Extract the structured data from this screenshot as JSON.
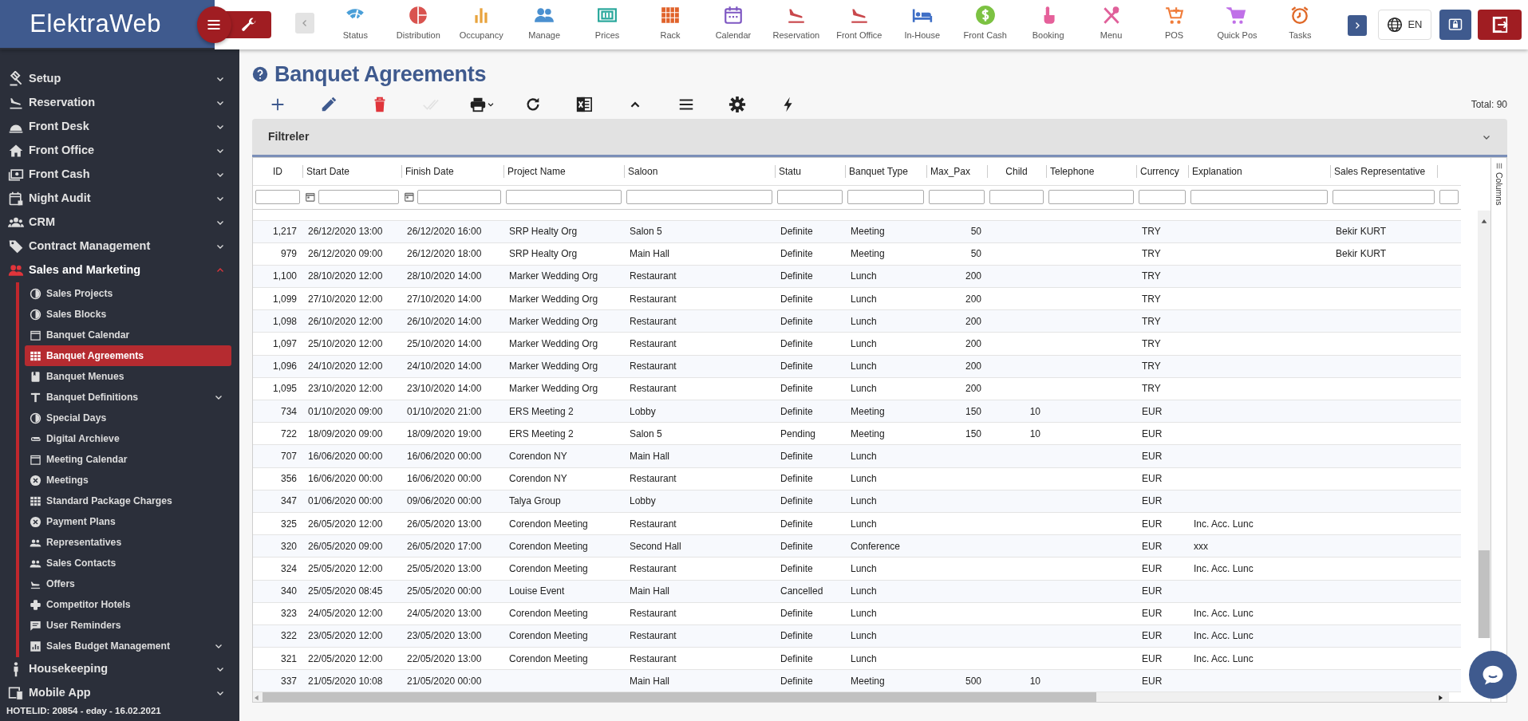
{
  "app": {
    "logo": "ElektraWeb"
  },
  "modules": [
    {
      "label": "Status"
    },
    {
      "label": "Distribution"
    },
    {
      "label": "Occupancy"
    },
    {
      "label": "Manage"
    },
    {
      "label": "Prices"
    },
    {
      "label": "Rack"
    },
    {
      "label": "Calendar"
    },
    {
      "label": "Reservation"
    },
    {
      "label": "Front Office"
    },
    {
      "label": "In-House"
    },
    {
      "label": "Front Cash"
    },
    {
      "label": "Booking"
    },
    {
      "label": "Menu"
    },
    {
      "label": "POS"
    },
    {
      "label": "Quick Pos"
    },
    {
      "label": "Tasks"
    }
  ],
  "language": {
    "label": "EN"
  },
  "sidebar": {
    "items": [
      {
        "label": "Setup",
        "expanded": false
      },
      {
        "label": "Reservation",
        "expanded": false
      },
      {
        "label": "Front Desk",
        "expanded": false
      },
      {
        "label": "Front Office",
        "expanded": false
      },
      {
        "label": "Front Cash",
        "expanded": false
      },
      {
        "label": "Night Audit",
        "expanded": false
      },
      {
        "label": "CRM",
        "expanded": false
      },
      {
        "label": "Contract Management",
        "expanded": false
      },
      {
        "label": "Sales and Marketing",
        "expanded": true,
        "children": [
          {
            "label": "Sales Projects",
            "selected": false,
            "expandable": false
          },
          {
            "label": "Sales Blocks",
            "selected": false,
            "expandable": false
          },
          {
            "label": "Banquet Calendar",
            "selected": false,
            "expandable": false
          },
          {
            "label": "Banquet Agreements",
            "selected": true,
            "expandable": false
          },
          {
            "label": "Banquet Menues",
            "selected": false,
            "expandable": false
          },
          {
            "label": "Banquet Definitions",
            "selected": false,
            "expandable": true
          },
          {
            "label": "Special Days",
            "selected": false,
            "expandable": false
          },
          {
            "label": "Digital Archieve",
            "selected": false,
            "expandable": false
          },
          {
            "label": "Meeting Calendar",
            "selected": false,
            "expandable": false
          },
          {
            "label": "Meetings",
            "selected": false,
            "expandable": false
          },
          {
            "label": "Standard Package Charges",
            "selected": false,
            "expandable": false
          },
          {
            "label": "Payment Plans",
            "selected": false,
            "expandable": false
          },
          {
            "label": "Representatives",
            "selected": false,
            "expandable": false
          },
          {
            "label": "Sales Contacts",
            "selected": false,
            "expandable": false
          },
          {
            "label": "Offers",
            "selected": false,
            "expandable": false
          },
          {
            "label": "Competitor Hotels",
            "selected": false,
            "expandable": false
          },
          {
            "label": "User Reminders",
            "selected": false,
            "expandable": false
          },
          {
            "label": "Sales Budget Management",
            "selected": false,
            "expandable": true
          }
        ]
      },
      {
        "label": "Housekeeping",
        "expanded": false
      },
      {
        "label": "Mobile App",
        "expanded": false
      }
    ],
    "footer": "HOTELID: 20854 - eday - 16.02.2021"
  },
  "page": {
    "title": "Banquet Agreements",
    "total": "Total: 90"
  },
  "toolbar": [
    {
      "kind": "add",
      "disabled": false
    },
    {
      "kind": "edit",
      "disabled": false
    },
    {
      "kind": "delete",
      "disabled": false
    },
    {
      "kind": "approve",
      "disabled": true
    },
    {
      "kind": "print",
      "disabled": false
    },
    {
      "kind": "refresh",
      "disabled": false
    },
    {
      "kind": "excel",
      "disabled": false
    },
    {
      "kind": "collapse",
      "disabled": false
    },
    {
      "kind": "menu",
      "disabled": false
    },
    {
      "kind": "settings",
      "disabled": false
    },
    {
      "kind": "flash",
      "disabled": false
    }
  ],
  "filter_panel": {
    "title": "Filtreler",
    "expanded": false
  },
  "side_tab": {
    "label": "Columns"
  },
  "table": {
    "columns": [
      "ID",
      "Start Date",
      "Finish Date",
      "Project Name",
      "Saloon",
      "Statu",
      "Banquet Type",
      "Max_Pax",
      "Child",
      "Telephone",
      "Currency",
      "Explanation",
      "Sales Representative"
    ],
    "rows": [
      [
        "1,217",
        "26/12/2020 13:00",
        "26/12/2020 16:00",
        "SRP Healty Org",
        "Salon 5",
        "Definite",
        "Meeting",
        "50",
        null,
        null,
        "TRY",
        null,
        "Bekir KURT"
      ],
      [
        "979",
        "26/12/2020 09:00",
        "26/12/2020 18:00",
        "SRP Healty Org",
        "Main Hall",
        "Definite",
        "Meeting",
        "50",
        null,
        null,
        "TRY",
        null,
        "Bekir KURT"
      ],
      [
        "1,100",
        "28/10/2020 12:00",
        "28/10/2020 14:00",
        "Marker Wedding Org",
        "Restaurant",
        "Definite",
        "Lunch",
        "200",
        null,
        null,
        "TRY",
        null,
        null
      ],
      [
        "1,099",
        "27/10/2020 12:00",
        "27/10/2020 14:00",
        "Marker Wedding Org",
        "Restaurant",
        "Definite",
        "Lunch",
        "200",
        null,
        null,
        "TRY",
        null,
        null
      ],
      [
        "1,098",
        "26/10/2020 12:00",
        "26/10/2020 14:00",
        "Marker Wedding Org",
        "Restaurant",
        "Definite",
        "Lunch",
        "200",
        null,
        null,
        "TRY",
        null,
        null
      ],
      [
        "1,097",
        "25/10/2020 12:00",
        "25/10/2020 14:00",
        "Marker Wedding Org",
        "Restaurant",
        "Definite",
        "Lunch",
        "200",
        null,
        null,
        "TRY",
        null,
        null
      ],
      [
        "1,096",
        "24/10/2020 12:00",
        "24/10/2020 14:00",
        "Marker Wedding Org",
        "Restaurant",
        "Definite",
        "Lunch",
        "200",
        null,
        null,
        "TRY",
        null,
        null
      ],
      [
        "1,095",
        "23/10/2020 12:00",
        "23/10/2020 14:00",
        "Marker Wedding Org",
        "Restaurant",
        "Definite",
        "Lunch",
        "200",
        null,
        null,
        "TRY",
        null,
        null
      ],
      [
        "734",
        "01/10/2020 09:00",
        "01/10/2020 21:00",
        "ERS Meeting 2",
        "Lobby",
        "Definite",
        "Meeting",
        "150",
        "10",
        null,
        "EUR",
        null,
        null
      ],
      [
        "722",
        "18/09/2020 09:00",
        "18/09/2020 19:00",
        "ERS Meeting 2",
        "Salon 5",
        "Pending",
        "Meeting",
        "150",
        "10",
        null,
        "EUR",
        null,
        null
      ],
      [
        "707",
        "16/06/2020 00:00",
        "16/06/2020 00:00",
        "Corendon NY",
        "Main Hall",
        "Definite",
        "Lunch",
        null,
        null,
        null,
        "EUR",
        null,
        null
      ],
      [
        "356",
        "16/06/2020 00:00",
        "16/06/2020 00:00",
        "Corendon NY",
        "Restaurant",
        "Definite",
        "Lunch",
        null,
        null,
        null,
        "EUR",
        null,
        null
      ],
      [
        "347",
        "01/06/2020 00:00",
        "09/06/2020 00:00",
        "Talya Group",
        "Lobby",
        "Definite",
        "Lunch",
        null,
        null,
        null,
        "EUR",
        null,
        null
      ],
      [
        "325",
        "26/05/2020 12:00",
        "26/05/2020 13:00",
        "Corendon Meeting",
        "Restaurant",
        "Definite",
        "Lunch",
        null,
        null,
        null,
        "EUR",
        "Inc. Acc. Lunc",
        null
      ],
      [
        "320",
        "26/05/2020 09:00",
        "26/05/2020 17:00",
        "Corendon Meeting",
        "Second Hall",
        "Definite",
        "Conference",
        null,
        null,
        null,
        "EUR",
        "xxx",
        null
      ],
      [
        "324",
        "25/05/2020 12:00",
        "25/05/2020 13:00",
        "Corendon Meeting",
        "Restaurant",
        "Definite",
        "Lunch",
        null,
        null,
        null,
        "EUR",
        "Inc. Acc. Lunc",
        null
      ],
      [
        "340",
        "25/05/2020 08:45",
        "25/05/2020 00:00",
        "Louise Event",
        "Main Hall",
        "Cancelled",
        "Lunch",
        null,
        null,
        null,
        "EUR",
        null,
        null
      ],
      [
        "323",
        "24/05/2020 12:00",
        "24/05/2020 13:00",
        "Corendon Meeting",
        "Restaurant",
        "Definite",
        "Lunch",
        null,
        null,
        null,
        "EUR",
        "Inc. Acc. Lunc",
        null
      ],
      [
        "322",
        "23/05/2020 12:00",
        "23/05/2020 13:00",
        "Corendon Meeting",
        "Restaurant",
        "Definite",
        "Lunch",
        null,
        null,
        null,
        "EUR",
        "Inc. Acc. Lunc",
        null
      ],
      [
        "321",
        "22/05/2020 12:00",
        "22/05/2020 13:00",
        "Corendon Meeting",
        "Restaurant",
        "Definite",
        "Lunch",
        null,
        null,
        null,
        "EUR",
        "Inc. Acc. Lunc",
        null
      ],
      [
        "337",
        "21/05/2020 10:08",
        "21/05/2020 00:00",
        null,
        "Main Hall",
        "Definite",
        "Meeting",
        "500",
        "10",
        null,
        "EUR",
        null,
        null
      ]
    ]
  }
}
